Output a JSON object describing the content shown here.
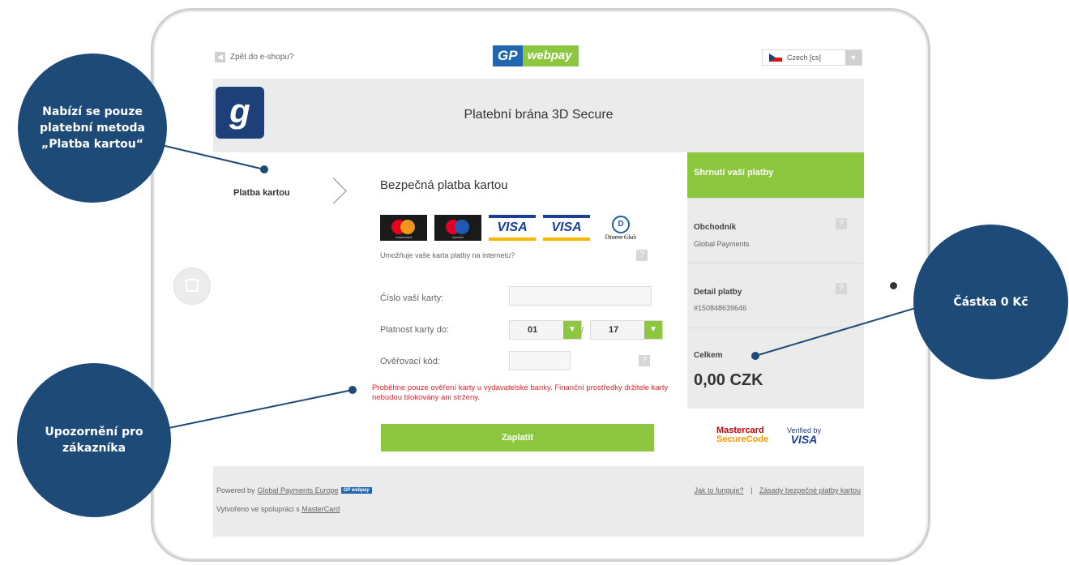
{
  "topbar": {
    "back_link": "Zpět do e-shopu?",
    "logo_gp": "GP",
    "logo_webpay": "webpay",
    "language": "Czech [cs]"
  },
  "header": {
    "title": "Platební brána 3D Secure"
  },
  "payment_method": {
    "label": "Platba kartou"
  },
  "form": {
    "title": "Bezpečná platba kartou",
    "cards": {
      "mastercard_small": "mastercard",
      "maestro_small": "maestro",
      "visa": "VISA",
      "visa_electron": "VISA",
      "diners_mark": "D",
      "diners": "Diners Club",
      "diners_sub": "INTERNATIONAL"
    },
    "support_question": "Umožňuje vaše karta platby na internetu?",
    "help_glyph": "?",
    "card_number_label": "Číslo vaší karty:",
    "card_number_value": "",
    "expiry_label": "Platnost karty do:",
    "expiry_month": "01",
    "expiry_year": "17",
    "expiry_separator": "/",
    "cvc_label": "Ověřovací kód:",
    "cvc_value": "",
    "warning": "Proběhne pouze ověření karty u vydavatelské banky. Finanční prostředky držitele karty nebudou blokovány ani strženy.",
    "pay_button": "Zaplatit"
  },
  "summary": {
    "heading": "Shrnutí vaší platby",
    "merchant_label": "Obchodník",
    "merchant_value": "Global Payments",
    "detail_label": "Detail platby",
    "detail_value": "#150848639646",
    "total_label": "Celkem",
    "total_value": "0,00 CZK",
    "securecode_1": "Mastercard",
    "securecode_2": "SecureCode",
    "vbv_1": "Verified by",
    "vbv_2": "VISA"
  },
  "footer": {
    "powered_prefix": "Powered by",
    "powered_link": "Global Payments Europe",
    "made_prefix": "Vytvořeno ve spolupráci s",
    "made_link": "MasterCard",
    "how_link": "Jak to funguje?",
    "separator": "|",
    "rules_link": "Zásady bezpečné platby kartou"
  },
  "callouts": {
    "payment_method_note": "Nabízí se pouze platební metoda „Platba kartou“",
    "amount_note": "Částka 0 Kč",
    "customer_notice": "Upozornění pro zákazníka"
  },
  "colors": {
    "accent_green": "#8dc63f",
    "callout_blue": "#1e4a77",
    "warning_red": "#e0262f",
    "gp_blue": "#2266b0"
  },
  "icons": [
    "back-arrow-icon",
    "czech-flag-icon",
    "dropdown-arrow-icon",
    "chevron-right-icon",
    "help-icon"
  ]
}
